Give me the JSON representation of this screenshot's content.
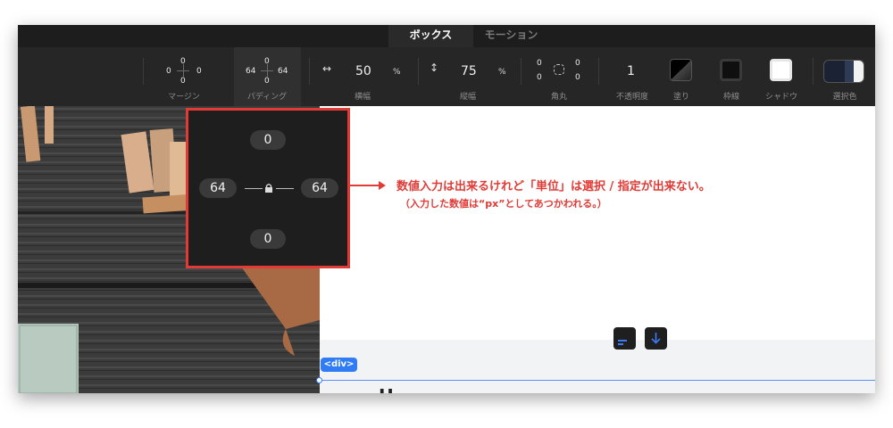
{
  "tabs": [
    {
      "label": "ボックス"
    },
    {
      "label": "モーション"
    }
  ],
  "toolbar": {
    "margin": {
      "top": "0",
      "left": "0",
      "right": "0",
      "bottom": "0",
      "label": "マージン"
    },
    "padding": {
      "top": "0",
      "left": "64",
      "right": "64",
      "bottom": "0",
      "label": "パディング"
    },
    "width": {
      "value": "50",
      "unit": "%",
      "label": "横幅"
    },
    "height": {
      "value": "75",
      "unit": "%",
      "label": "縦幅"
    },
    "radius": {
      "tl": "0",
      "tr": "0",
      "bl": "0",
      "br": "0",
      "label": "角丸"
    },
    "opacity": {
      "value": "1",
      "label": "不透明度"
    },
    "fill": {
      "label": "塗り"
    },
    "border": {
      "label": "枠線"
    },
    "shadow": {
      "label": "シャドウ"
    },
    "selection_color": {
      "label": "選択色"
    }
  },
  "popup": {
    "top": "0",
    "left": "64",
    "right": "64",
    "bottom": "0"
  },
  "annotation": {
    "line1": "数値入力は出来るけれど「単位」は選択 / 指定が出来ない。",
    "line2": "（入力した数値は“px”としてあつかわれる。）"
  },
  "canvas": {
    "div_tag": "<div>"
  },
  "colors": {
    "annotation_red": "#e03b36",
    "accent_blue": "#2f7cf6"
  }
}
